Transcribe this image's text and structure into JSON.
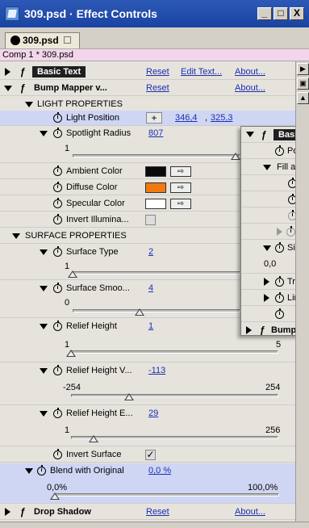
{
  "window": {
    "title": "309.psd · Effect Controls",
    "minimize_label": "_",
    "maximize_label": "□",
    "close_label": "X"
  },
  "tab": {
    "label": "309.psd"
  },
  "comp_path": "Comp 1 * 309.psd",
  "effects": {
    "basic_text": {
      "name": "Basic Text",
      "reset": "Reset",
      "edit_text": "Edit Text...",
      "about": "About..."
    },
    "bump_mapper": {
      "name": "Bump Mapper v...",
      "reset": "Reset",
      "about": "About..."
    },
    "drop_shadow": {
      "name": "Drop Shadow",
      "reset": "Reset",
      "about": "About..."
    }
  },
  "light_properties": {
    "header": "LIGHT PROPERTIES",
    "light_position": {
      "label": "Light Position",
      "x": "346,4",
      "y": "325,3",
      "separator": ","
    },
    "spotlight_radius": {
      "label": "Spotlight Radius",
      "value": "807",
      "min_label": "1",
      "fraction": 0.97
    },
    "ambient_color": {
      "label": "Ambient Color",
      "color": "#0a0a0a"
    },
    "diffuse_color": {
      "label": "Diffuse Color",
      "color": "#f07a10"
    },
    "specular_color": {
      "label": "Specular Color",
      "color": "#ffffff"
    },
    "invert_illumination": {
      "label": "Invert Illumina...",
      "checked": false
    }
  },
  "surface_properties": {
    "header": "SURFACE PROPERTIES",
    "surface_type": {
      "label": "Surface Type",
      "value": "2",
      "min_label": "1",
      "fraction": 0.0
    },
    "surface_smoothness": {
      "label": "Surface Smoo...",
      "value": "4",
      "min_label": "0",
      "fraction": 0.4
    },
    "relief_height": {
      "label": "Relief Height",
      "value": "1",
      "min_label": "1",
      "max_label": "5",
      "fraction": 0.0
    },
    "relief_height_v": {
      "label": "Relief Height V...",
      "value": "-113",
      "min_label": "-254",
      "max_label": "254",
      "fraction": 0.28
    },
    "relief_height_e": {
      "label": "Relief Height E...",
      "value": "29",
      "min_label": "1",
      "max_label": "256",
      "fraction": 0.11
    },
    "invert_surface": {
      "label": "Invert Surface",
      "checked": true
    }
  },
  "blend": {
    "label": "Blend with Original",
    "value": "0,0 %",
    "min_label": "0,0%",
    "max_label": "100,0%",
    "fraction": 0.0
  },
  "overlay": {
    "title": "Basic",
    "items": [
      "Positi",
      "Fill and S",
      "D",
      "F",
      "S",
      "S",
      "Size",
      "0,0",
      "Track",
      "Line S",
      "",
      "Bump"
    ]
  },
  "icons": {
    "fx": "fx-icon",
    "stopwatch": "stopwatch-icon",
    "eyedropper": "eyedropper-icon",
    "crosshair": "crosshair-icon"
  },
  "colors": {
    "title_bar": "#1f48a8",
    "comp_row": "#f3d6ec",
    "link": "#1c2fb0",
    "selection": "#cfd6f4"
  }
}
